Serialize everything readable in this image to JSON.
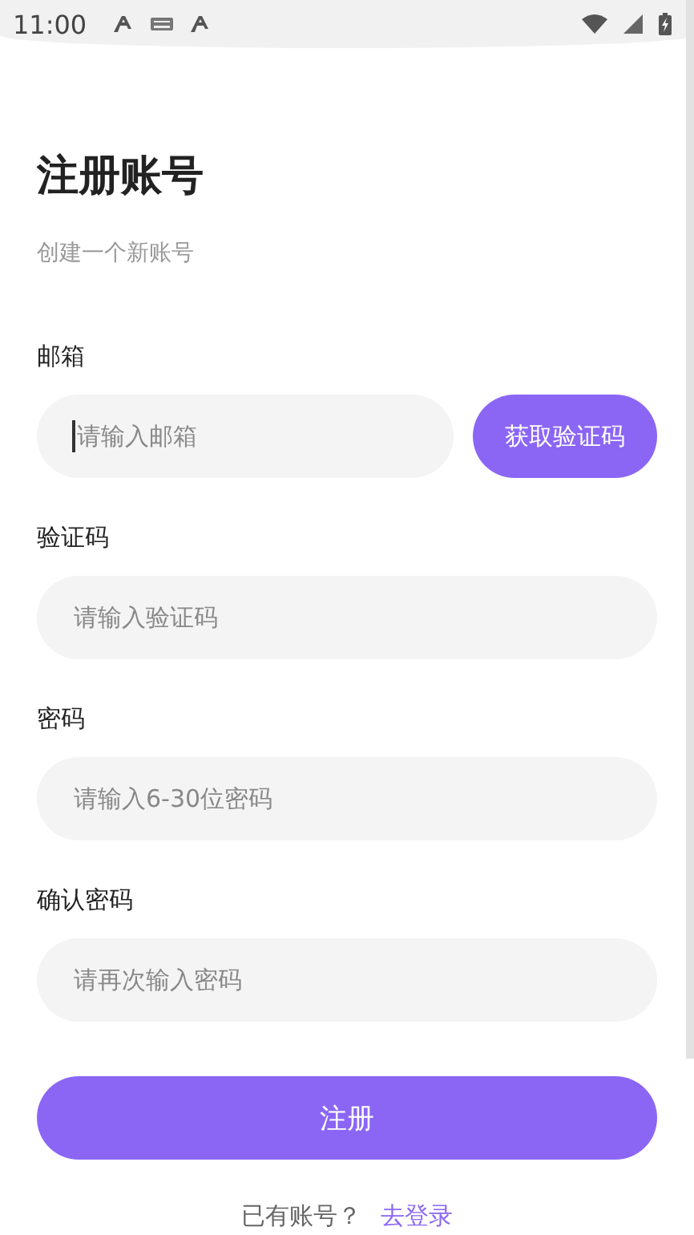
{
  "status_bar": {
    "time": "11:00"
  },
  "title": "注册账号",
  "subtitle": "创建一个新账号",
  "fields": [
    {
      "kind": "with_button",
      "label": "邮箱",
      "placeholder": "请输入邮箱",
      "focused": true,
      "button": "获取验证码"
    },
    {
      "kind": "plain",
      "label": "验证码",
      "placeholder": "请输入验证码",
      "focused": false
    },
    {
      "kind": "plain",
      "label": "密码",
      "placeholder": "请输入6-30位密码",
      "focused": false
    },
    {
      "kind": "plain",
      "label": "确认密码",
      "placeholder": "请再次输入密码",
      "focused": false
    }
  ],
  "submit": "注册",
  "footer": {
    "text": "已有账号？",
    "link": "去登录"
  }
}
